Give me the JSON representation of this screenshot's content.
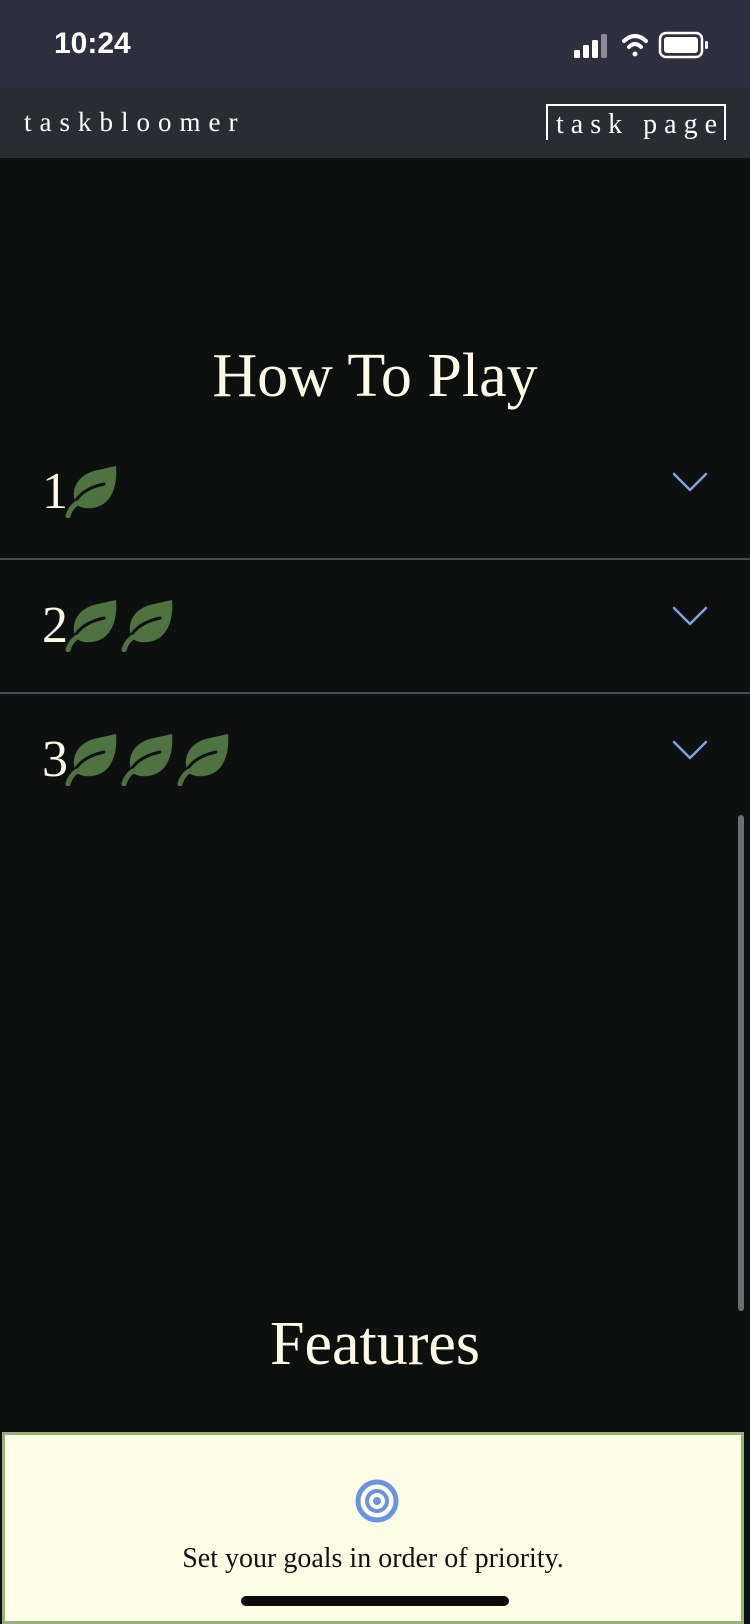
{
  "status_bar": {
    "time": "10:24",
    "icons": [
      "signal-icon",
      "wifi-icon",
      "battery-icon"
    ]
  },
  "nav": {
    "brand": "taskbloomer",
    "link_label": "task page"
  },
  "how_to_play": {
    "title": "How To Play",
    "rows": [
      {
        "number": "1",
        "leaf_count": 1
      },
      {
        "number": "2",
        "leaf_count": 2
      },
      {
        "number": "3",
        "leaf_count": 3
      }
    ]
  },
  "features": {
    "title": "Features",
    "items": [
      {
        "icon": "target-icon",
        "text": "Set your goals in order of priority."
      }
    ]
  },
  "colors": {
    "status_bar_bg": "#302f40",
    "nav_bg": "#2a2c31",
    "page_bg": "#0e100f",
    "heading_text": "#fdfae6",
    "leaf_green": "#4f7340",
    "chevron_blue": "#7ea2e6",
    "card_bg": "#fefde6",
    "card_border": "#93b27c",
    "target_blue": "#6a93e3"
  }
}
